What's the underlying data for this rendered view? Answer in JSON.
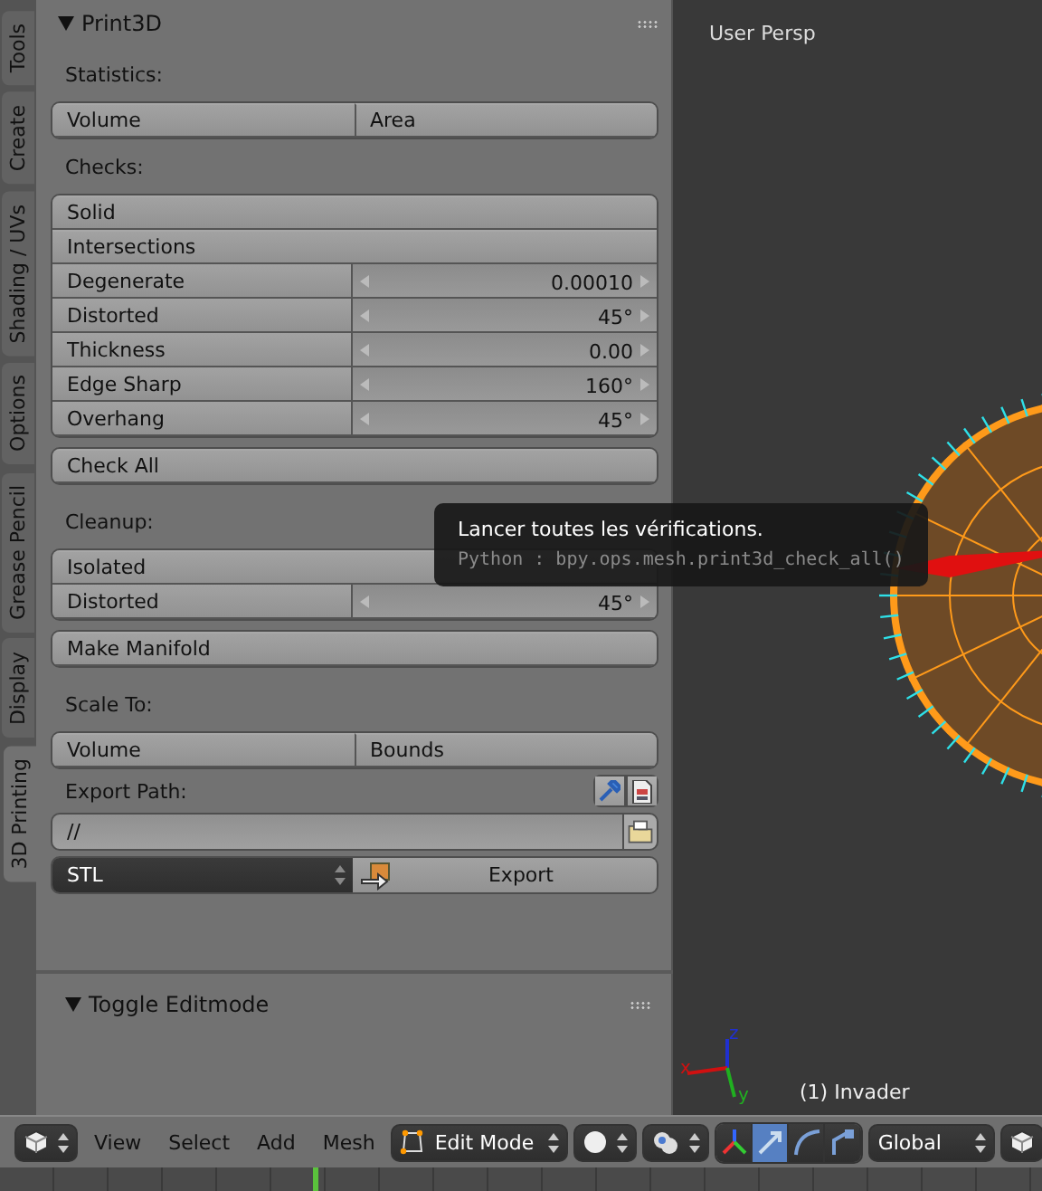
{
  "tool_tabs": [
    {
      "label": "Tools",
      "selected": false
    },
    {
      "label": "Create",
      "selected": false
    },
    {
      "label": "Shading / UVs",
      "selected": false
    },
    {
      "label": "Options",
      "selected": false
    },
    {
      "label": "Grease Pencil",
      "selected": false
    },
    {
      "label": "Display",
      "selected": false
    },
    {
      "label": "3D Printing",
      "selected": true
    }
  ],
  "panel": {
    "title": "Print3D",
    "blocks": [
      {
        "kind": "heading",
        "text": "Statistics:"
      },
      {
        "kind": "pair",
        "labels": [
          "Volume",
          "Area"
        ]
      },
      {
        "kind": "heading",
        "text": "Checks:"
      },
      {
        "kind": "stack",
        "rows": [
          {
            "kind": "button",
            "label": "Solid"
          },
          {
            "kind": "button",
            "label": "Intersections"
          },
          {
            "kind": "number",
            "label": "Degenerate",
            "value": "0.00010"
          },
          {
            "kind": "number",
            "label": "Distorted",
            "value": "45°"
          },
          {
            "kind": "number",
            "label": "Thickness",
            "value": "0.00"
          },
          {
            "kind": "number",
            "label": "Edge Sharp",
            "value": "160°"
          },
          {
            "kind": "number",
            "label": "Overhang",
            "value": "45°"
          }
        ]
      },
      {
        "kind": "button",
        "label": "Check All"
      },
      {
        "kind": "heading",
        "text": "Cleanup:"
      },
      {
        "kind": "stack",
        "rows": [
          {
            "kind": "button",
            "label": "Isolated"
          },
          {
            "kind": "number",
            "label": "Distorted",
            "value": "45°"
          }
        ]
      },
      {
        "kind": "button",
        "label": "Make Manifold"
      },
      {
        "kind": "heading",
        "text": "Scale To:"
      },
      {
        "kind": "pair",
        "labels": [
          "Volume",
          "Bounds"
        ]
      },
      {
        "kind": "path",
        "label": "Export Path:",
        "value": "//"
      },
      {
        "kind": "export",
        "format": "STL",
        "action": "Export"
      }
    ]
  },
  "tooltip": {
    "text": "Lancer toutes les vérifications.",
    "python": "Python : bpy.ops.mesh.print3d_check_all()"
  },
  "operator_panel": {
    "title": "Toggle Editmode"
  },
  "viewport": {
    "view_label": "User Persp",
    "object_label": "(1) Invader",
    "axes": [
      "x",
      "y",
      "z"
    ]
  },
  "header": {
    "menus": [
      "View",
      "Select",
      "Add",
      "Mesh"
    ],
    "mode": "Edit Mode",
    "orientation": "Global",
    "manipulators": [
      {
        "kind": "axes",
        "selected": false
      },
      {
        "kind": "translate",
        "selected": true
      },
      {
        "kind": "rotate",
        "selected": false
      },
      {
        "kind": "scale",
        "selected": false
      }
    ]
  }
}
